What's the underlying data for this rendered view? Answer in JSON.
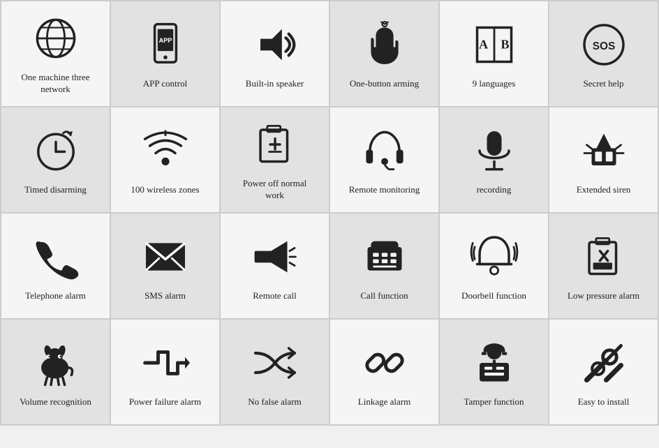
{
  "cells": [
    {
      "id": "one-machine",
      "label": "One machine three network",
      "bg": "light"
    },
    {
      "id": "app-control",
      "label": "APP control",
      "bg": "dark"
    },
    {
      "id": "built-in-speaker",
      "label": "Built-in speaker",
      "bg": "light"
    },
    {
      "id": "one-button",
      "label": "One-button arming",
      "bg": "dark"
    },
    {
      "id": "9-languages",
      "label": "9 languages",
      "bg": "light"
    },
    {
      "id": "secret-help",
      "label": "Secret help",
      "bg": "dark"
    },
    {
      "id": "timed-disarming",
      "label": "Timed disarming",
      "bg": "dark"
    },
    {
      "id": "100-wireless",
      "label": "100 wireless zones",
      "bg": "light"
    },
    {
      "id": "power-off",
      "label": "Power off normal work",
      "bg": "dark"
    },
    {
      "id": "remote-monitoring",
      "label": "Remote monitoring",
      "bg": "light"
    },
    {
      "id": "recording",
      "label": "recording",
      "bg": "dark"
    },
    {
      "id": "extended-siren",
      "label": "Extended siren",
      "bg": "light"
    },
    {
      "id": "telephone-alarm",
      "label": "Telephone alarm",
      "bg": "light"
    },
    {
      "id": "sms-alarm",
      "label": "SMS alarm",
      "bg": "dark"
    },
    {
      "id": "remote-call",
      "label": "Remote call",
      "bg": "light"
    },
    {
      "id": "call-function",
      "label": "Call function",
      "bg": "dark"
    },
    {
      "id": "doorbell",
      "label": "Doorbell function",
      "bg": "light"
    },
    {
      "id": "low-pressure",
      "label": "Low pressure alarm",
      "bg": "dark"
    },
    {
      "id": "volume-recognition",
      "label": "Volume recognition",
      "bg": "dark"
    },
    {
      "id": "power-failure",
      "label": "Power failure alarm",
      "bg": "light"
    },
    {
      "id": "no-false",
      "label": "No false alarm",
      "bg": "dark"
    },
    {
      "id": "linkage",
      "label": "Linkage alarm",
      "bg": "light"
    },
    {
      "id": "tamper",
      "label": "Tamper function",
      "bg": "dark"
    },
    {
      "id": "easy-install",
      "label": "Easy to install",
      "bg": "light"
    }
  ]
}
